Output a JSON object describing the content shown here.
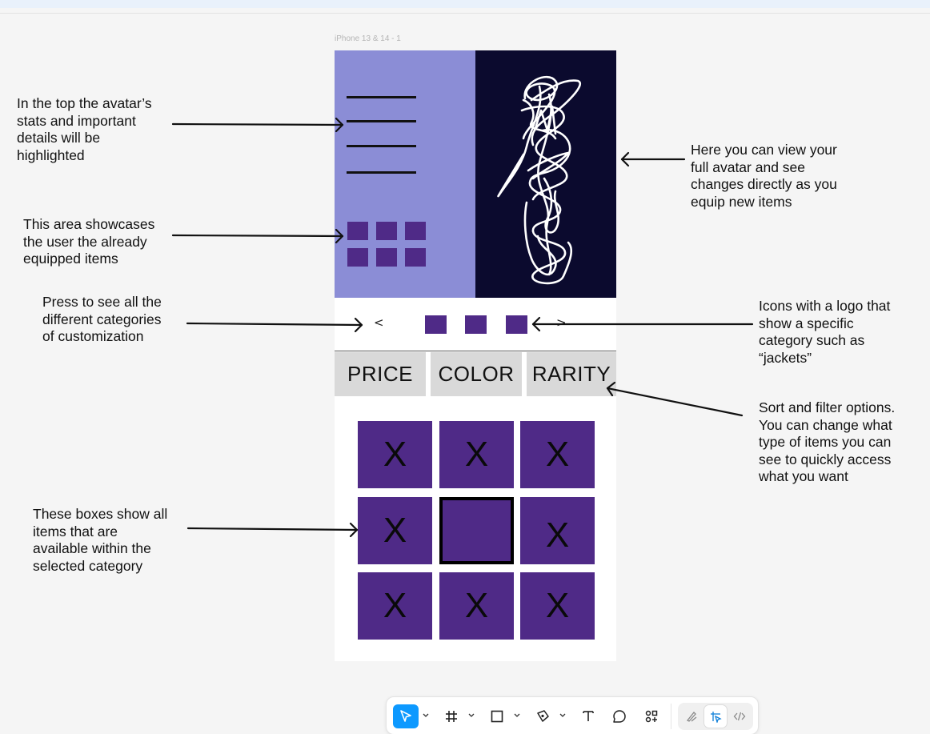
{
  "frame": {
    "label": "iPhone 13 & 14 - 1"
  },
  "filters": [
    {
      "label": "PRICE"
    },
    {
      "label": "COLOR"
    },
    {
      "label": "RARITY"
    }
  ],
  "category_bar": {
    "prev": "<",
    "next": ">"
  },
  "items": [
    "X",
    "X",
    "X",
    "X",
    "",
    "X",
    "X",
    "X",
    "X"
  ],
  "annotations": {
    "stats": "In the top the avatar’s\nstats and important\ndetails will be\nhighlighted",
    "equipped": "This area showcases\nthe user the already\nequipped items",
    "categories": "Press to see all the\ndifferent categories\nof customization",
    "items": "These boxes show all\nitems that are\navailable within the\nselected category",
    "avatar": "Here you can view your\nfull avatar and see\nchanges directly as you\nequip new items",
    "icons": "Icons with a logo that\nshow a specific\ncategory such as\n“jackets”",
    "filters": "Sort and filter options.\nYou can change what\ntype of items you can\nsee to quickly access\nwhat you want"
  },
  "colors": {
    "stats_panel": "#8b8dd6",
    "avatar_panel": "#0b0a2e",
    "item_purple": "#4f2a87",
    "filter_gray": "#d9d9d9",
    "canvas": "#f5f5f5",
    "toolbar_active": "#0d99ff"
  },
  "toolbar": {
    "tools": [
      "move-tool-icon",
      "frame-tool-icon",
      "rectangle-tool-icon",
      "pen-tool-icon",
      "text-tool-icon",
      "comment-tool-icon",
      "actions-icon"
    ],
    "modes": [
      "draw-mode-icon",
      "design-mode-icon",
      "dev-mode-icon"
    ]
  }
}
